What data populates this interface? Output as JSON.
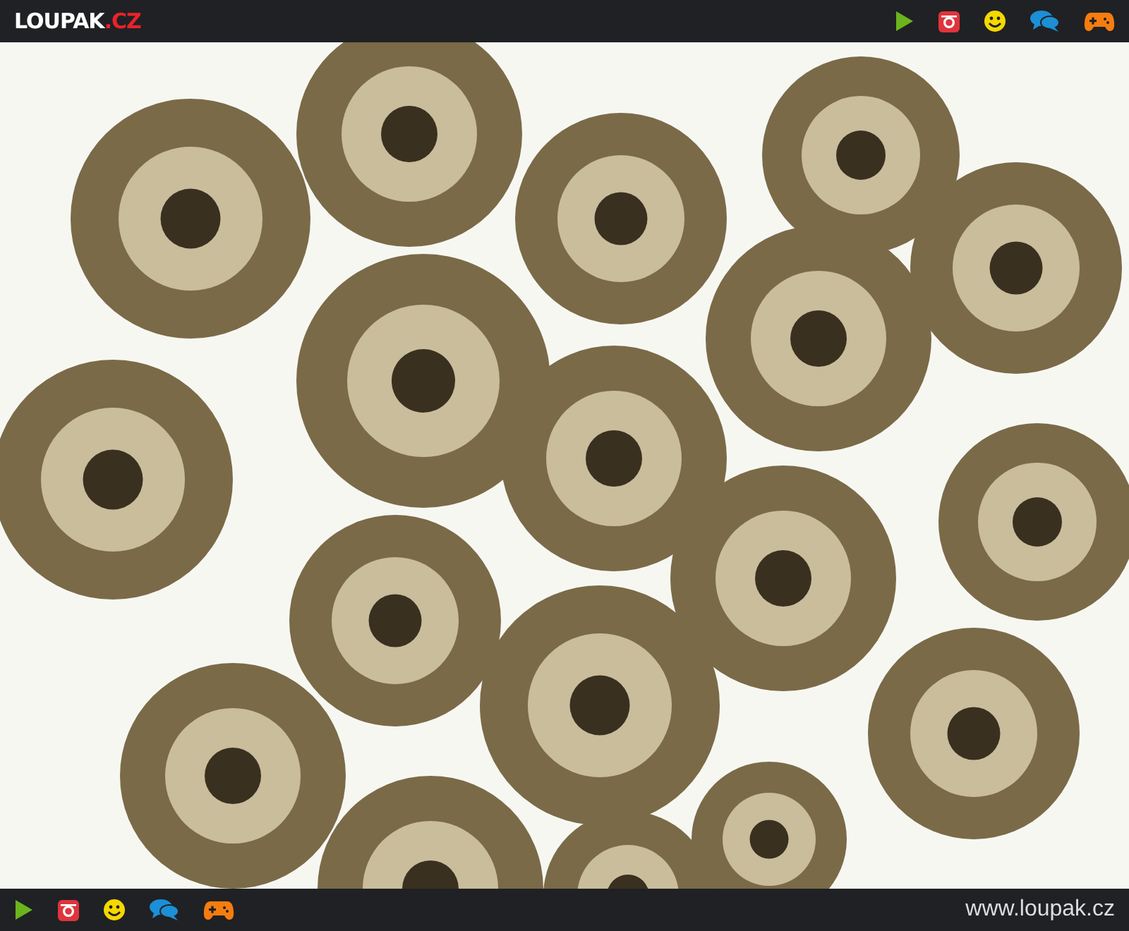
{
  "header": {
    "logo": {
      "name": "LOUPAK",
      "suffix": ".CZ"
    }
  },
  "footer": {
    "url": "www.loupak.cz"
  }
}
